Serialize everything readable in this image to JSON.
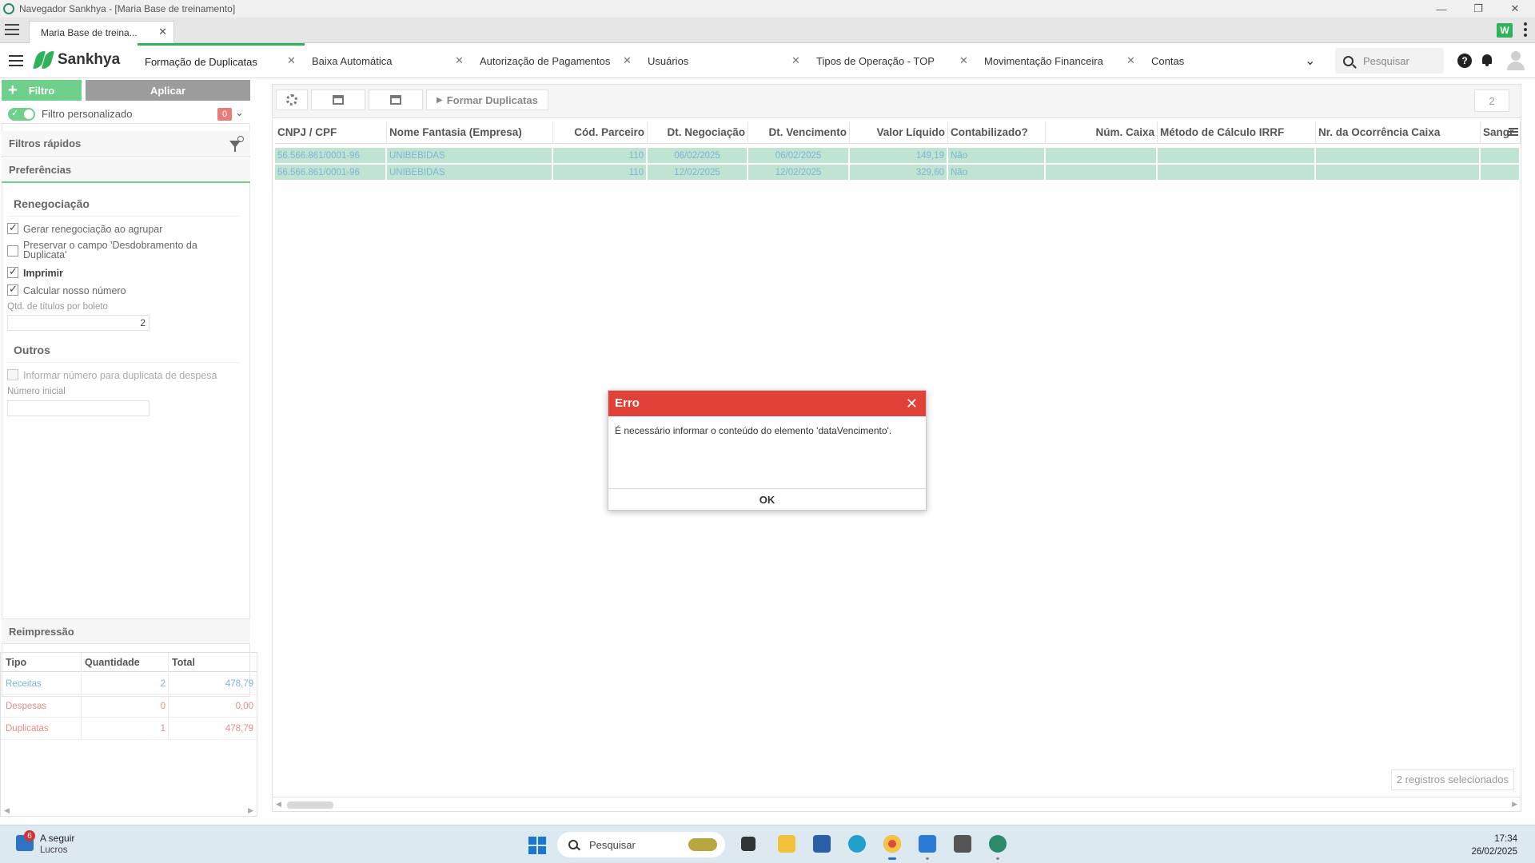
{
  "window": {
    "title": "Navegador Sankhya - [Maria Base de treinamento]"
  },
  "browser": {
    "tab_label": "Maria Base de treina..."
  },
  "app": {
    "logo_text": "Sankhya",
    "tabs": [
      {
        "label": "Formação de Duplicatas",
        "active": true
      },
      {
        "label": "Baixa Automática"
      },
      {
        "label": "Autorização de Pagamentos"
      },
      {
        "label": "Usuários"
      },
      {
        "label": "Tipos de Operação - TOP"
      },
      {
        "label": "Movimentação Financeira"
      },
      {
        "label": "Contas"
      }
    ],
    "search_placeholder": "Pesquisar",
    "help_glyph": "?"
  },
  "left_panel": {
    "filtro_label": "Filtro",
    "aplicar_label": "Aplicar",
    "filtro_personalizado": "Filtro personalizado",
    "filter_count": "0",
    "filtros_rapidos": "Filtros rápidos",
    "preferencias": "Preferências",
    "renegociacao": {
      "title": "Renegociação",
      "options": [
        {
          "label": "Gerar renegociação ao agrupar",
          "checked": true
        },
        {
          "label": "Preservar o campo 'Desdobramento da Duplicata'",
          "checked": false
        },
        {
          "label": "Imprimir",
          "checked": true
        },
        {
          "label": "Calcular nosso número",
          "checked": true
        }
      ],
      "qtd_label": "Qtd. de títulos por boleto",
      "qtd_value": "2"
    },
    "outros": {
      "title": "Outros",
      "option_label": "Informar número para duplicata de despesa",
      "numero_inicial_label": "Número inicial",
      "numero_inicial_value": ""
    },
    "reimpressao": "Reimpressão"
  },
  "summary": {
    "headers": [
      "Tipo",
      "Quantidade",
      "Total"
    ],
    "rows": [
      {
        "tipo": "Receitas",
        "quantidade": "2",
        "total": "478,79",
        "color": "#7cb4d8"
      },
      {
        "tipo": "Despesas",
        "quantidade": "0",
        "total": "0,00",
        "color": "#e88a8a"
      },
      {
        "tipo": "Duplicatas",
        "quantidade": "1",
        "total": "478,79",
        "color": "#e88a8a"
      }
    ]
  },
  "toolbar": {
    "formar_label": "Formar Duplicatas",
    "count": "2"
  },
  "grid": {
    "columns": [
      "CNPJ / CPF",
      "Nome Fantasia (Empresa)",
      "Cód. Parceiro",
      "Dt. Negociação",
      "Dt. Vencimento",
      "Valor Líquido",
      "Contabilizado?",
      "Núm. Caixa",
      "Método de Cálculo IRRF",
      "Nr. da Ocorrência Caixa",
      "Sangr"
    ],
    "rows": [
      [
        "56.566.861/0001-96",
        "UNIBEBIDAS",
        "110",
        "06/02/2025",
        "06/02/2025",
        "149,19",
        "Não",
        "",
        "",
        "",
        ""
      ],
      [
        "56.566.861/0001-96",
        "UNIBEBIDAS",
        "110",
        "12/02/2025",
        "12/02/2025",
        "329,60",
        "Não",
        "",
        "",
        "",
        ""
      ]
    ],
    "selected_text": "2 registros selecionados"
  },
  "dialog": {
    "title": "Erro",
    "message": "É necessário informar o conteúdo do elemento 'dataVencimento'.",
    "ok_label": "OK"
  },
  "taskbar": {
    "news_badge": "6",
    "news_title": "A seguir",
    "news_subtitle": "Lucros",
    "search_placeholder": "Pesquisar",
    "time": "17:34",
    "date": "26/02/2025"
  }
}
